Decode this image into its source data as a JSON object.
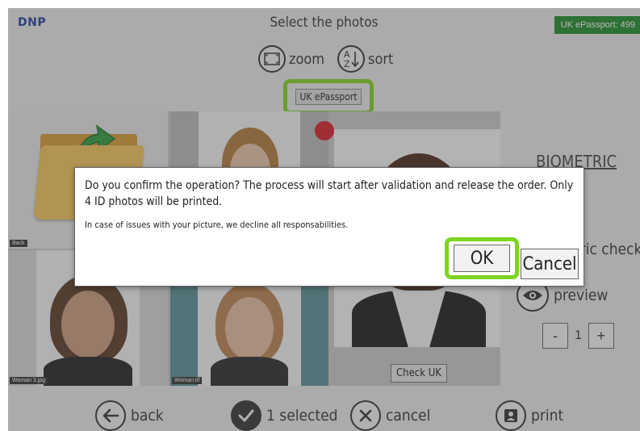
{
  "header": {
    "logo": "DNP",
    "title": "Select the photos",
    "badge": "UK ePassport: 499"
  },
  "toolbar": {
    "zoom_label": "zoom",
    "sort_label": "sort",
    "zoom_icon": "zoom-frame-icon",
    "sort_icon": "sort-az-icon"
  },
  "format_tag": "UK ePassport",
  "tiles": [
    {
      "caption": "Back",
      "kind": "folder"
    },
    {
      "caption": "",
      "kind": "portrait"
    },
    {
      "caption": "",
      "kind": "portrait-large"
    },
    {
      "caption": "Woman 3.jpg",
      "kind": "portrait"
    },
    {
      "caption": "Woman.tif",
      "kind": "portrait-selected"
    }
  ],
  "right_panel": {
    "biometric_title": "BIOMETRIC",
    "check_label": "tric check",
    "preview_label": "preview",
    "quantity": "1",
    "minus_label": "-",
    "plus_label": "+"
  },
  "check_uk_label": "Check UK",
  "bottom": {
    "back_label": "back",
    "selected_label": "1 selected",
    "cancel_label": "cancel",
    "print_label": "print"
  },
  "dialog": {
    "message": "Do you confirm the operation? The process will start after validation and release the order. Only 4 ID photos will be printed.",
    "sub_message": "In case of issues with your picture, we decline all responsabilities.",
    "ok_label": "OK",
    "cancel_label": "Cancel"
  },
  "colors": {
    "highlight": "#7ed320",
    "badge_bg": "#1d8c2b",
    "logo": "#1f3e9c",
    "status_dot": "#d9202a"
  }
}
